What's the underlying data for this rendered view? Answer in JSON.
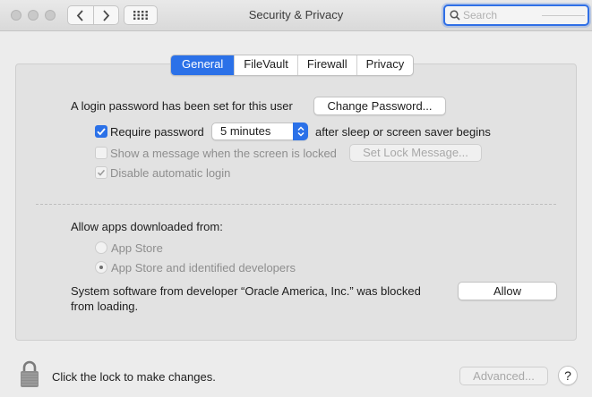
{
  "window": {
    "title": "Security & Privacy"
  },
  "toolbar": {
    "search_placeholder": "Search",
    "back_icon": "chevron-left-icon",
    "forward_icon": "chevron-right-icon",
    "grid_icon": "show-all-grid-icon"
  },
  "tabs": [
    {
      "label": "General",
      "selected": true
    },
    {
      "label": "FileVault",
      "selected": false
    },
    {
      "label": "Firewall",
      "selected": false
    },
    {
      "label": "Privacy",
      "selected": false
    }
  ],
  "general": {
    "password_set_text": "A login password has been set for this user",
    "change_password_button": "Change Password...",
    "require_password": {
      "label": "Require password",
      "checked": true
    },
    "require_password_delay": "5 minutes",
    "require_password_suffix": "after sleep or screen saver begins",
    "show_message": {
      "label": "Show a message when the screen is locked",
      "checked": false,
      "enabled": false
    },
    "set_lock_message_button": "Set Lock Message...",
    "disable_auto_login": {
      "label": "Disable automatic login",
      "checked": true,
      "enabled": false
    },
    "allow_apps_heading": "Allow apps downloaded from:",
    "radio_app_store": {
      "label": "App Store",
      "selected": false
    },
    "radio_identified": {
      "label": "App Store and identified developers",
      "selected": true
    },
    "blocked_text_line1": "System software from developer “Oracle America, Inc.” was blocked",
    "blocked_text_line2": "from loading.",
    "allow_button": "Allow"
  },
  "footer": {
    "lock_text": "Click the lock to make changes.",
    "advanced_button": "Advanced...",
    "help_label": "?"
  },
  "colors": {
    "accent": "#2b71e8",
    "panel": "#e2e2e2",
    "window": "#ececec"
  }
}
